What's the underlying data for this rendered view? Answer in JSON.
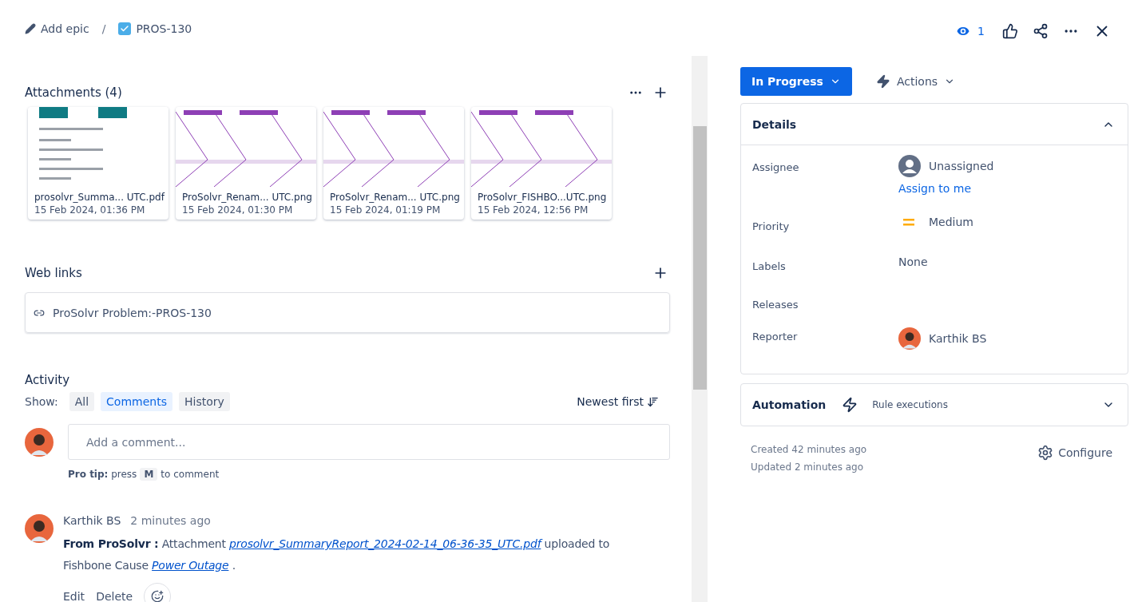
{
  "header": {
    "breadcrumb": [
      {
        "kind": "epic",
        "label": "Add epic"
      },
      {
        "kind": "issue",
        "label": "PROS-130"
      }
    ],
    "separator": "/",
    "watchers": "1"
  },
  "attachments": {
    "title": "Attachments (4)",
    "items": [
      {
        "kind": "pdf",
        "name": "prosolvr_Summa... UTC.pdf",
        "date": "15 Feb 2024, 01:36 PM"
      },
      {
        "kind": "fishbone",
        "name": "ProSolvr_Renam... UTC.png",
        "date": "15 Feb 2024, 01:30 PM"
      },
      {
        "kind": "fishbone",
        "name": "ProSolvr_Renam... UTC.png",
        "date": "15 Feb 2024, 01:19 PM"
      },
      {
        "kind": "fishbone",
        "name": "ProSolvr_FISHBO...UTC.png",
        "date": "15 Feb 2024, 12:56 PM"
      }
    ]
  },
  "web_links": {
    "title": "Web links",
    "items": [
      {
        "label": "ProSolvr Problem:-PROS-130"
      }
    ]
  },
  "activity": {
    "title": "Activity",
    "show_label": "Show:",
    "filters": [
      {
        "label": "All",
        "selected": false
      },
      {
        "label": "Comments",
        "selected": true
      },
      {
        "label": "History",
        "selected": false
      }
    ],
    "sort": "Newest first",
    "comment_placeholder": "Add a comment...",
    "pro_tip": {
      "prefix": "**Pro tip:** press",
      "key": "M",
      "suffix": "to comment"
    },
    "comments": [
      {
        "author": "Karthik BS",
        "time": "2 minutes ago",
        "body": [
          {
            "kind": "text",
            "text": "**From ProSolvr :** Attachment "
          },
          {
            "kind": "link",
            "text": "prosolvr_SummaryReport_2024-02-14_06-36-35_UTC.pdf"
          },
          {
            "kind": "text",
            "text": "  uploaded to Fishbone Cause "
          },
          {
            "kind": "link",
            "text": "Power Outage"
          },
          {
            "kind": "text",
            "text": " ."
          }
        ],
        "actions": [
          "Edit",
          "Delete"
        ]
      }
    ]
  },
  "sidebar": {
    "status": "In Progress",
    "actions": "Actions",
    "details": {
      "title": "Details",
      "expanded": true,
      "fields": [
        {
          "kind": "assignee",
          "label": "Assignee",
          "value": "Unassigned",
          "action": "Assign to me"
        },
        {
          "kind": "priority",
          "label": "Priority",
          "value": "Medium"
        },
        {
          "kind": "text",
          "label": "Labels",
          "value": "None"
        },
        {
          "kind": "empty",
          "label": "Releases"
        },
        {
          "kind": "user",
          "label": "Reporter",
          "value": "Karthik BS"
        }
      ]
    },
    "automation": {
      "title": "Automation",
      "subtitle": "Rule executions",
      "expanded": false
    },
    "created": "Created 42 minutes ago",
    "updated": "Updated 2 minutes ago",
    "configure": "Configure"
  }
}
